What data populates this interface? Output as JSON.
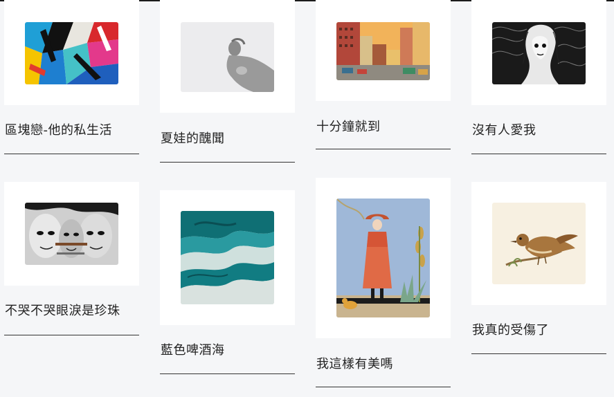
{
  "gallery": {
    "items": [
      {
        "title": "區塊戀-他的私生活",
        "artwork": "abstract-geometric-mural"
      },
      {
        "title": "夏娃的醜聞",
        "artwork": "marble-statue"
      },
      {
        "title": "十分鐘就到",
        "artwork": "vintage-city-street"
      },
      {
        "title": "沒有人愛我",
        "artwork": "ink-woman-portrait"
      },
      {
        "title": "不哭不哭眼淚是珍珠",
        "artwork": "graffiti-faces"
      },
      {
        "title": "藍色啤酒海",
        "artwork": "teal-marble-swirl"
      },
      {
        "title": "我這樣有美嗎",
        "artwork": "art-deco-fashion-lady"
      },
      {
        "title": "我真的受傷了",
        "artwork": "bird-on-branch"
      }
    ]
  }
}
